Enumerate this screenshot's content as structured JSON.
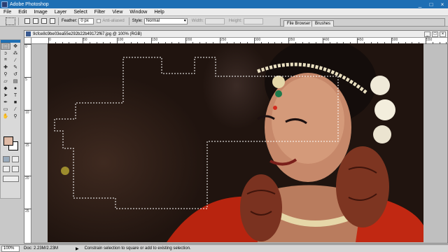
{
  "window": {
    "title": "Adobe Photoshop",
    "controls": [
      "_",
      "□",
      "×"
    ]
  },
  "menu": [
    "File",
    "Edit",
    "Image",
    "Layer",
    "Select",
    "Filter",
    "View",
    "Window",
    "Help"
  ],
  "options": {
    "feather_label": "Feather:",
    "feather_value": "0 px",
    "antialiased_label": "Anti-aliased",
    "style_label": "Style:",
    "style_value": "Normal",
    "width_label": "Width:",
    "height_label": "Height:"
  },
  "palette_well": {
    "tabs": [
      "File Browser",
      "Brushes"
    ]
  },
  "document": {
    "title": "9cfce8c9be03ea55e292b22b49172f67.jpg @ 100% (RGB)",
    "ruler_h": [
      "0",
      "50",
      "100",
      "150",
      "200",
      "250",
      "300",
      "350",
      "400",
      "450",
      "500",
      "550"
    ],
    "ruler_v": [
      "0",
      "5",
      "10",
      "15",
      "20",
      "25",
      "30"
    ]
  },
  "colors": {
    "foreground": "#e0bba6",
    "background": "#ffffff",
    "titlebar": "#1e6fb4"
  },
  "status": {
    "zoom": "100%",
    "doc": "Doc: 2.23M/2.23M",
    "hint": "Constrain selection to square or add to existing selection."
  }
}
